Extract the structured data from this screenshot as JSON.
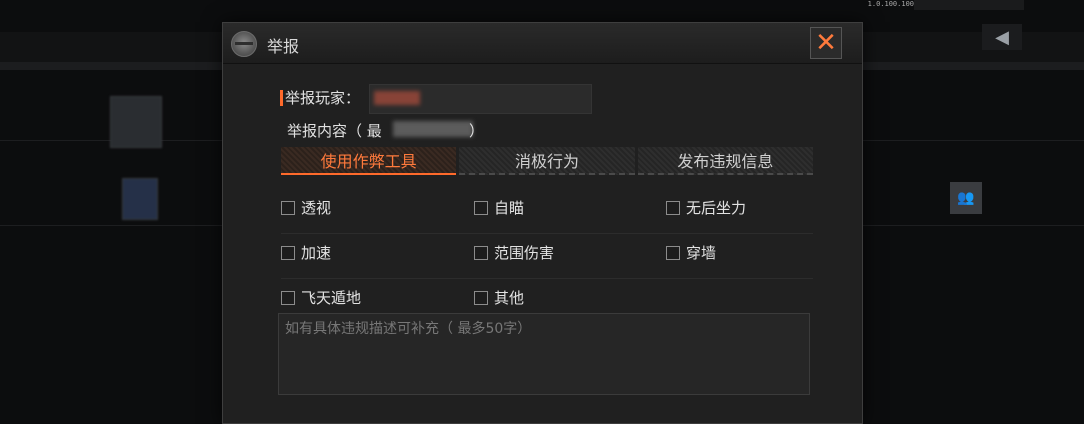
{
  "background": {
    "ip_text": "1.0.100.100",
    "back_icon": "back-arrow-icon",
    "group_icon": "users-icon"
  },
  "dialog": {
    "title": "举报",
    "close_glyph": "✕",
    "player_label": "举报玩家：",
    "content_label": "举报内容（ 最",
    "content_label_end": "）",
    "tabs": [
      {
        "label": "使用作弊工具",
        "active": true
      },
      {
        "label": "消极行为",
        "active": false
      },
      {
        "label": "发布违规信息",
        "active": false
      }
    ],
    "options": [
      [
        "透视",
        "自瞄",
        "无后坐力"
      ],
      [
        "加速",
        "范围伤害",
        "穿墙"
      ],
      [
        "飞天遁地",
        "其他"
      ]
    ],
    "description_placeholder": "如有具体违规描述可补充（ 最多50字）"
  },
  "colors": {
    "accent": "#ff6a2b",
    "dialog_bg": "#202020"
  }
}
